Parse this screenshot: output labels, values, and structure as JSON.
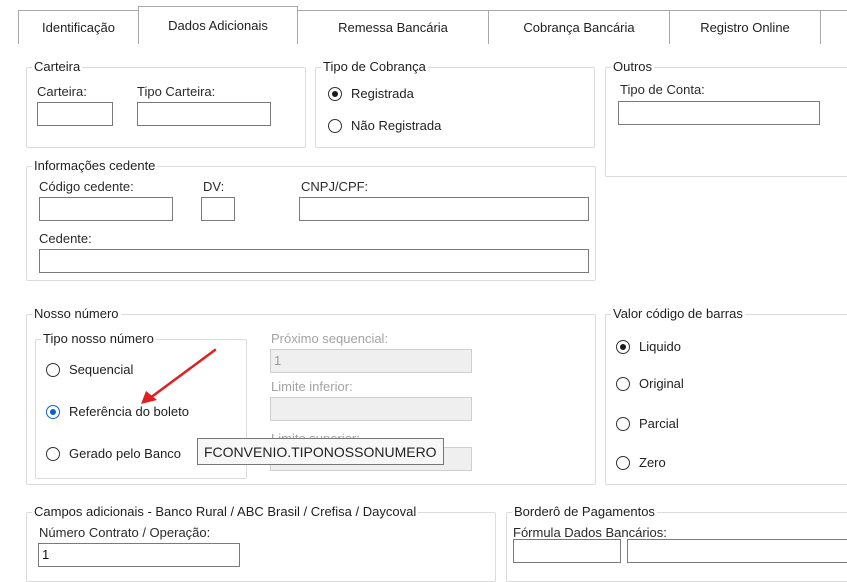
{
  "tabs": [
    {
      "label": "Identificação"
    },
    {
      "label": "Dados Adicionais"
    },
    {
      "label": "Remessa Bancária"
    },
    {
      "label": "Cobrança Bancária"
    },
    {
      "label": "Registro Online"
    }
  ],
  "carteira": {
    "legend": "Carteira",
    "carteira_label": "Carteira:",
    "carteira_value": "",
    "tipo_label": "Tipo Carteira:",
    "tipo_value": ""
  },
  "tipo_cobranca": {
    "legend": "Tipo de Cobrança",
    "options": [
      {
        "label": "Registrada",
        "selected": true
      },
      {
        "label": "Não Registrada",
        "selected": false
      }
    ]
  },
  "outros": {
    "legend": "Outros",
    "tipo_conta_label": "Tipo de Conta:",
    "tipo_conta_value": ""
  },
  "cedente": {
    "legend": "Informações cedente",
    "codigo_label": "Código cedente:",
    "codigo_value": "",
    "dv_label": "DV:",
    "dv_value": "",
    "cnpj_label": "CNPJ/CPF:",
    "cnpj_value": "",
    "cedente_label": "Cedente:",
    "cedente_value": ""
  },
  "nosso_numero": {
    "legend": "Nosso número",
    "tipo_legend": "Tipo nosso número",
    "options": [
      {
        "label": "Sequencial",
        "selected": false
      },
      {
        "label": "Referência do boleto",
        "selected": true
      },
      {
        "label": "Gerado pelo Banco",
        "selected": false
      }
    ],
    "proximo_label": "Próximo sequencial:",
    "proximo_value": "1",
    "limite_inferior_label": "Limite inferior:",
    "limite_inferior_value": "",
    "limite_superior_label": "Limite superior:",
    "limite_superior_value": ""
  },
  "valor_codigo": {
    "legend": "Valor código de barras",
    "options": [
      {
        "label": "Liquido",
        "selected": true
      },
      {
        "label": "Original",
        "selected": false
      },
      {
        "label": "Parcial",
        "selected": false
      },
      {
        "label": "Zero",
        "selected": false
      }
    ]
  },
  "campos_adicionais": {
    "legend": "Campos adicionais - Banco Rural / ABC Brasil / Crefisa / Daycoval",
    "contrato_label": "Número Contrato / Operação:",
    "contrato_value": "1"
  },
  "bordero": {
    "legend": "Borderô de Pagamentos",
    "formula_label": "Fórmula Dados Bancários:",
    "formula_value": ""
  },
  "tooltip": {
    "text": "FCONVENIO.TIPONOSSONUMERO"
  },
  "colors": {
    "accent": "#0a64c8",
    "annotation_arrow": "#e02020"
  }
}
